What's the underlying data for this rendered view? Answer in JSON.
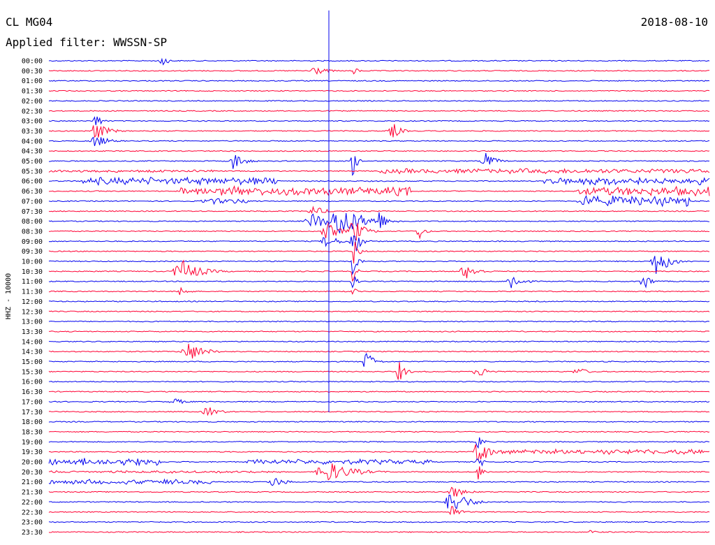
{
  "header": {
    "station": "CL MG04",
    "filter": "Applied filter: WWSSN-SP",
    "date": "2018-08-10"
  },
  "chart_data": {
    "type": "line",
    "subtype": "helicorder",
    "ylabel": "HHZ - 10000",
    "row_labels": [
      "00:00",
      "00:30",
      "01:00",
      "01:30",
      "02:00",
      "02:30",
      "03:00",
      "03:30",
      "04:00",
      "04:30",
      "05:00",
      "05:30",
      "06:00",
      "06:30",
      "07:00",
      "07:30",
      "08:00",
      "08:30",
      "09:00",
      "09:30",
      "10:00",
      "10:30",
      "11:00",
      "11:30",
      "12:00",
      "12:30",
      "13:00",
      "13:30",
      "14:00",
      "14:30",
      "15:00",
      "15:30",
      "16:00",
      "16:30",
      "17:00",
      "17:30",
      "18:00",
      "18:30",
      "19:00",
      "19:30",
      "20:00",
      "20:30",
      "21:00",
      "21:30",
      "22:00",
      "22:30",
      "23:00",
      "23:30"
    ],
    "colors": {
      "even": "#0000ee",
      "odd": "#ff0033"
    },
    "events": [
      {
        "row": 0,
        "x": 0.17,
        "amp": 14,
        "w": 0.004
      },
      {
        "row": 1,
        "x": 0.4,
        "amp": 8,
        "w": 0.01
      },
      {
        "row": 1,
        "x": 0.46,
        "amp": 8,
        "w": 0.004
      },
      {
        "row": 6,
        "x": 0.07,
        "amp": 12,
        "w": 0.005
      },
      {
        "row": 7,
        "x": 0.07,
        "amp": 14,
        "w": 0.01
      },
      {
        "row": 7,
        "x": 0.52,
        "amp": 14,
        "w": 0.006
      },
      {
        "row": 8,
        "x": 0.07,
        "amp": 10,
        "w": 0.01
      },
      {
        "row": 10,
        "x": 0.28,
        "amp": 14,
        "w": 0.008
      },
      {
        "row": 10,
        "x": 0.46,
        "amp": 26,
        "w": 0.003
      },
      {
        "row": 10,
        "x": 0.66,
        "amp": 16,
        "w": 0.007
      },
      {
        "row": 15,
        "x": 0.4,
        "amp": 8,
        "w": 0.01
      },
      {
        "row": 16,
        "x": 0.4,
        "amp": 12,
        "w": 0.015
      },
      {
        "row": 16,
        "x": 0.44,
        "amp": 24,
        "w": 0.02
      },
      {
        "row": 16,
        "x": 0.5,
        "amp": 18,
        "w": 0.005
      },
      {
        "row": 17,
        "x": 0.42,
        "amp": 14,
        "w": 0.01
      },
      {
        "row": 17,
        "x": 0.46,
        "amp": 22,
        "w": 0.008
      },
      {
        "row": 17,
        "x": 0.56,
        "amp": 16,
        "w": 0.004
      },
      {
        "row": 18,
        "x": 0.42,
        "amp": 10,
        "w": 0.01
      },
      {
        "row": 18,
        "x": 0.46,
        "amp": 30,
        "w": 0.005
      },
      {
        "row": 19,
        "x": 0.46,
        "amp": 24,
        "w": 0.004
      },
      {
        "row": 20,
        "x": 0.46,
        "amp": 22,
        "w": 0.004
      },
      {
        "row": 20,
        "x": 0.92,
        "amp": 22,
        "w": 0.01
      },
      {
        "row": 21,
        "x": 0.2,
        "amp": 18,
        "w": 0.015
      },
      {
        "row": 21,
        "x": 0.46,
        "amp": 16,
        "w": 0.003
      },
      {
        "row": 21,
        "x": 0.63,
        "amp": 12,
        "w": 0.01
      },
      {
        "row": 22,
        "x": 0.46,
        "amp": 14,
        "w": 0.003
      },
      {
        "row": 22,
        "x": 0.7,
        "amp": 14,
        "w": 0.008
      },
      {
        "row": 22,
        "x": 0.9,
        "amp": 14,
        "w": 0.006
      },
      {
        "row": 23,
        "x": 0.2,
        "amp": 10,
        "w": 0.005
      },
      {
        "row": 23,
        "x": 0.46,
        "amp": 8,
        "w": 0.003
      },
      {
        "row": 29,
        "x": 0.21,
        "amp": 16,
        "w": 0.012
      },
      {
        "row": 30,
        "x": 0.48,
        "amp": 18,
        "w": 0.006
      },
      {
        "row": 31,
        "x": 0.53,
        "amp": 16,
        "w": 0.005
      },
      {
        "row": 31,
        "x": 0.65,
        "amp": 8,
        "w": 0.01
      },
      {
        "row": 31,
        "x": 0.8,
        "amp": 7,
        "w": 0.008
      },
      {
        "row": 34,
        "x": 0.19,
        "amp": 5,
        "w": 0.01
      },
      {
        "row": 35,
        "x": 0.24,
        "amp": 8,
        "w": 0.01
      },
      {
        "row": 38,
        "x": 0.65,
        "amp": 12,
        "w": 0.004
      },
      {
        "row": 39,
        "x": 0.65,
        "amp": 26,
        "w": 0.007
      },
      {
        "row": 40,
        "x": 0.65,
        "amp": 12,
        "w": 0.004
      },
      {
        "row": 41,
        "x": 0.42,
        "amp": 16,
        "w": 0.02
      },
      {
        "row": 41,
        "x": 0.65,
        "amp": 14,
        "w": 0.004
      },
      {
        "row": 42,
        "x": 0.34,
        "amp": 8,
        "w": 0.01
      },
      {
        "row": 43,
        "x": 0.61,
        "amp": 10,
        "w": 0.01
      },
      {
        "row": 44,
        "x": 0.61,
        "amp": 20,
        "w": 0.012
      },
      {
        "row": 45,
        "x": 0.61,
        "amp": 12,
        "w": 0.006
      },
      {
        "row": 47,
        "x": 0.82,
        "amp": 6,
        "w": 0.003
      }
    ],
    "noisy_segments": [
      {
        "row": 11,
        "start": 0.5,
        "end": 1.0,
        "amp": 4
      },
      {
        "row": 11,
        "start": 0.0,
        "end": 0.25,
        "amp": 2
      },
      {
        "row": 12,
        "start": 0.05,
        "end": 0.35,
        "amp": 6
      },
      {
        "row": 12,
        "start": 0.75,
        "end": 1.0,
        "amp": 6
      },
      {
        "row": 13,
        "start": 0.2,
        "end": 0.55,
        "amp": 7
      },
      {
        "row": 13,
        "start": 0.8,
        "end": 1.0,
        "amp": 7
      },
      {
        "row": 14,
        "start": 0.23,
        "end": 0.3,
        "amp": 5
      },
      {
        "row": 14,
        "start": 0.8,
        "end": 0.97,
        "amp": 8
      },
      {
        "row": 39,
        "start": 0.68,
        "end": 1.0,
        "amp": 4
      },
      {
        "row": 40,
        "start": 0.0,
        "end": 0.17,
        "amp": 6
      },
      {
        "row": 40,
        "start": 0.3,
        "end": 0.58,
        "amp": 4
      },
      {
        "row": 42,
        "start": 0.0,
        "end": 0.25,
        "amp": 4
      },
      {
        "row": 41,
        "start": 0.0,
        "end": 0.35,
        "amp": 2
      }
    ]
  }
}
